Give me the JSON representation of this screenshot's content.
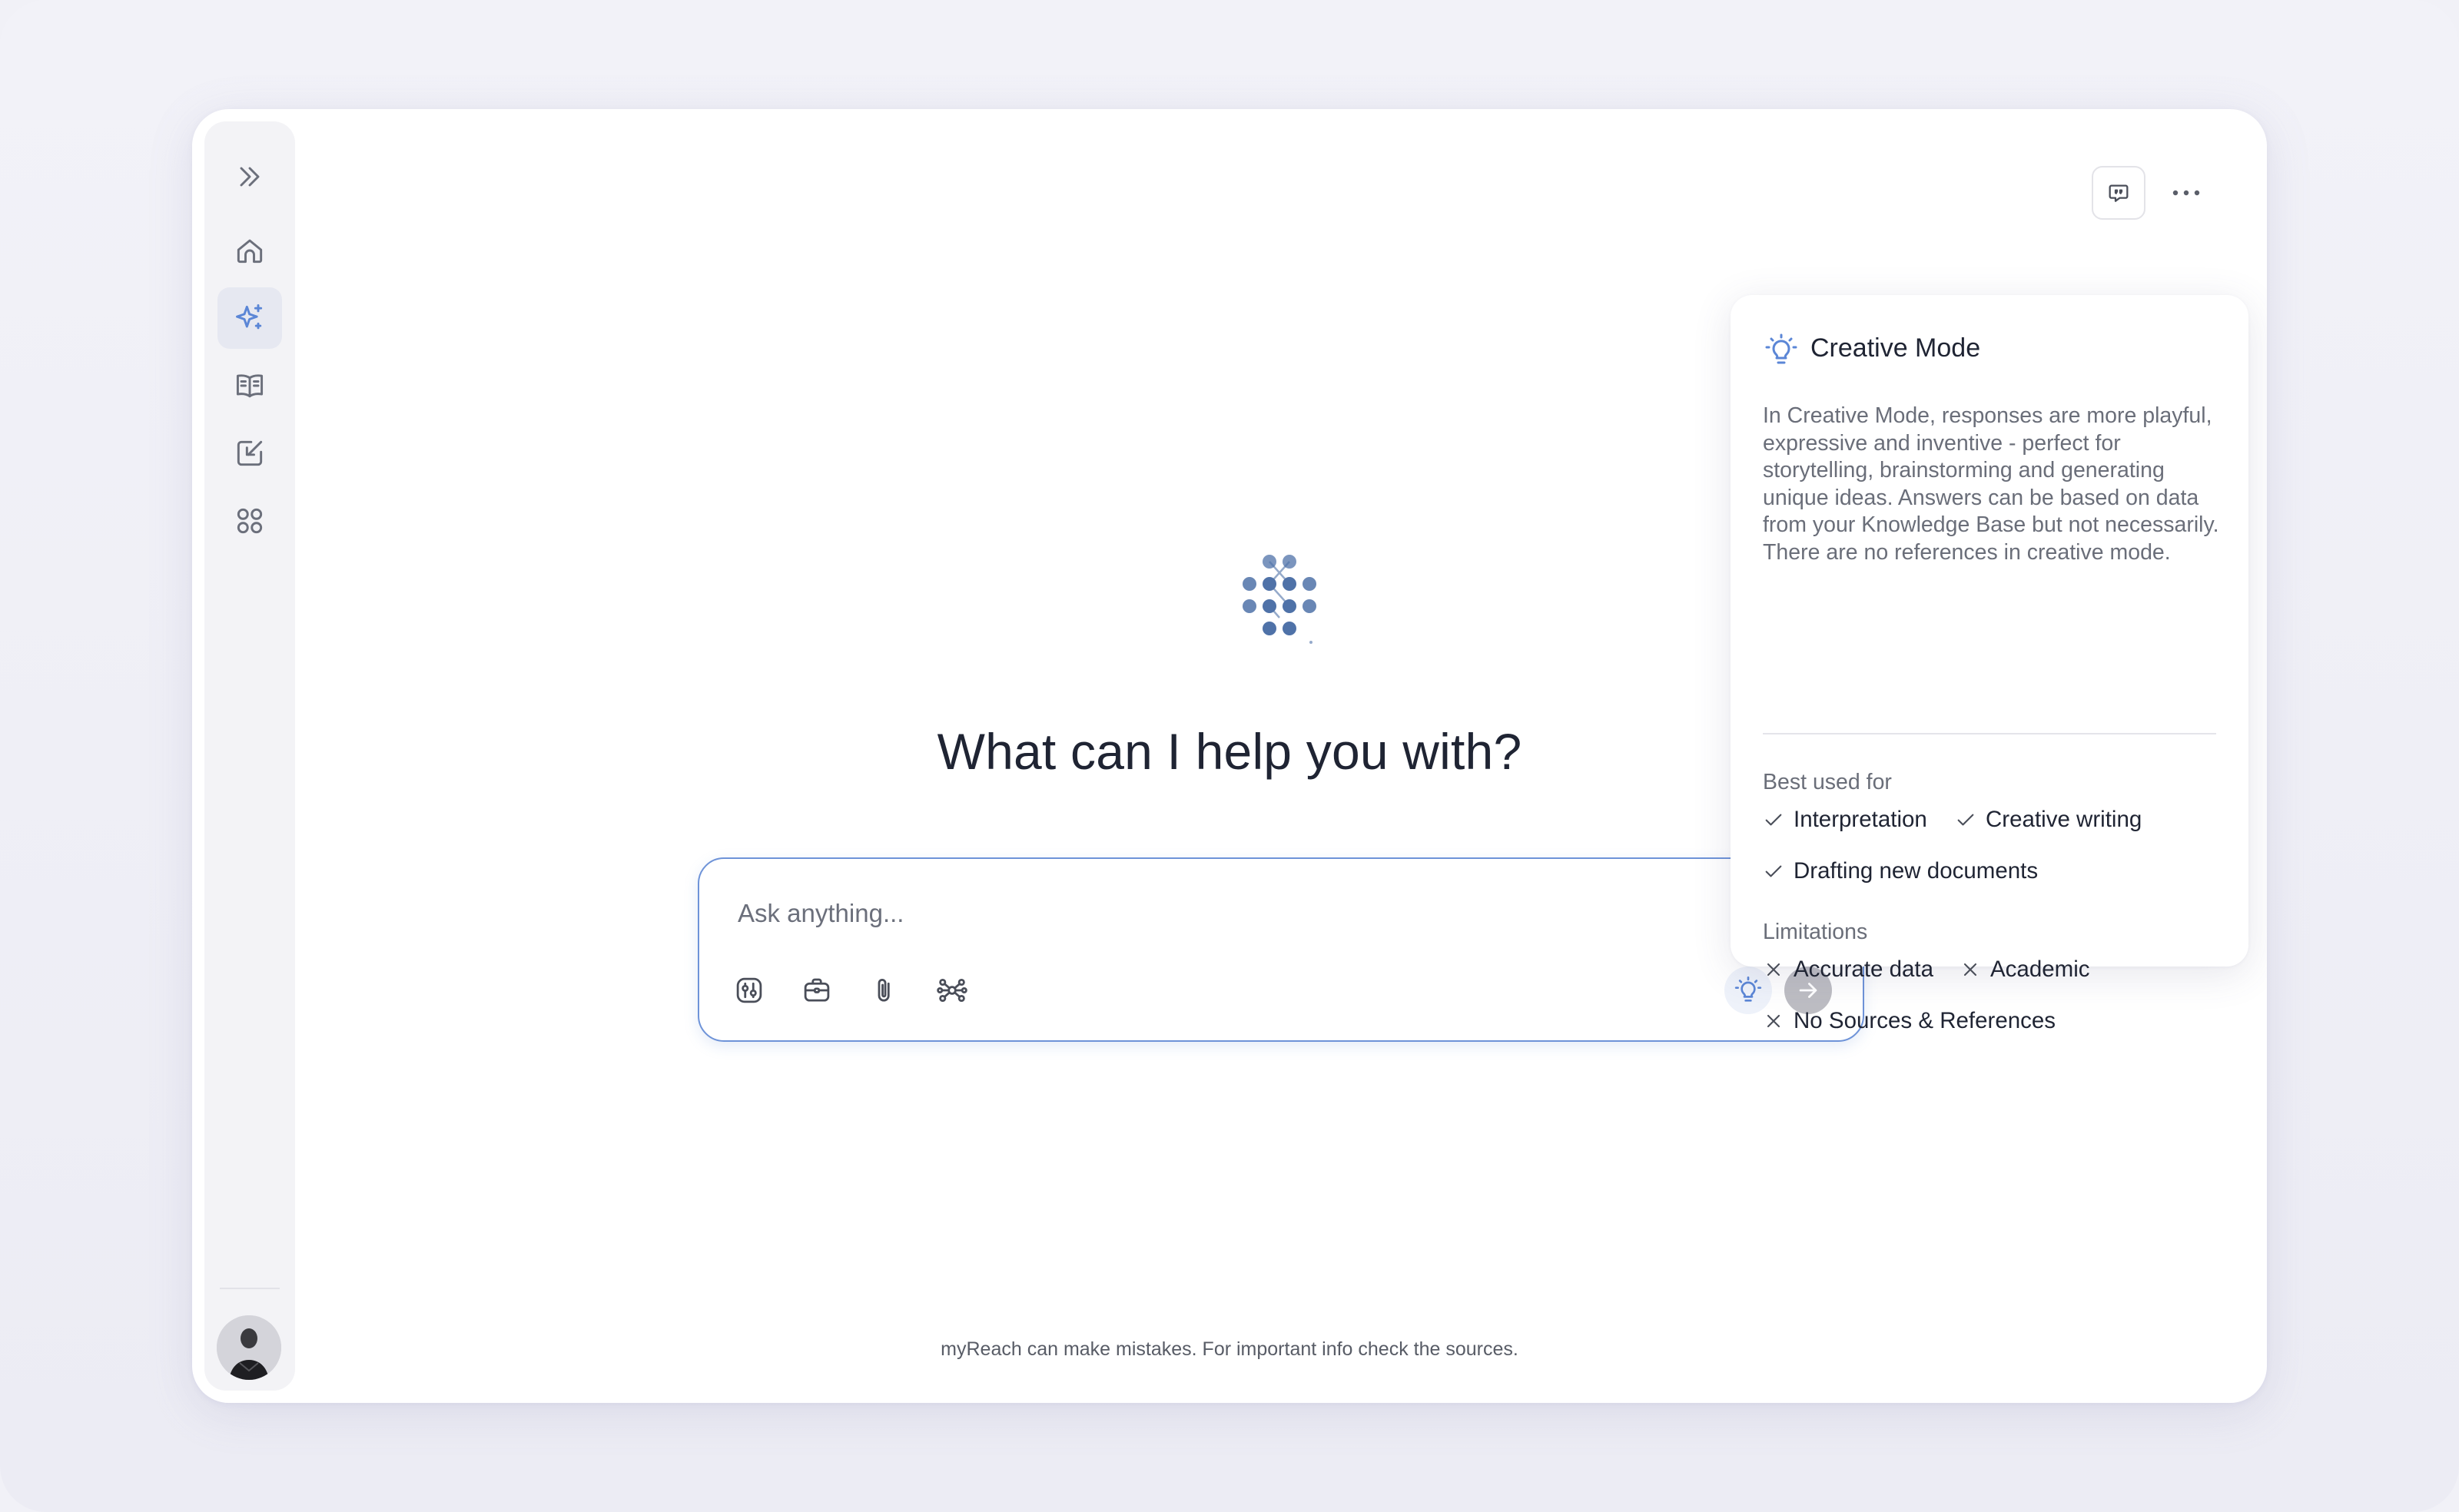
{
  "sidebar": {
    "items": [
      {
        "icon": "chevrons-right-icon"
      },
      {
        "icon": "home-icon"
      },
      {
        "icon": "sparkles-icon",
        "active": true
      },
      {
        "icon": "book-icon"
      },
      {
        "icon": "import-icon"
      },
      {
        "icon": "apps-grid-icon"
      }
    ],
    "avatar": "user-avatar"
  },
  "header": {
    "quote_icon": "quote-icon",
    "more_icon": "more-horizontal-icon"
  },
  "main": {
    "headline": "What can I help you with?",
    "composer": {
      "placeholder": "Ask anything...",
      "tools": [
        "sliders-icon",
        "briefcase-icon",
        "paperclip-icon",
        "network-icon"
      ],
      "mode_icon": "lightbulb-icon",
      "send_icon": "arrow-right-icon"
    },
    "footer_note": "myReach can make mistakes. For important info check the sources."
  },
  "popover": {
    "title": "Creative Mode",
    "description": "In Creative Mode, responses are more playful, expressive and inventive - perfect for storytelling, brainstorming and generating unique ideas. Answers can be based on data from your Knowledge Base but not necessarily. There are no references in creative mode.",
    "best_used_for_label": "Best used for",
    "best_used_for": [
      "Interpretation",
      "Creative writing",
      "Drafting new documents"
    ],
    "limitations_label": "Limitations",
    "limitations": [
      "Accurate data",
      "Academic",
      "No Sources & References"
    ]
  },
  "colors": {
    "accent": "#5b86d6",
    "logo": "#4f72a8",
    "icon": "#6b6f7b"
  }
}
